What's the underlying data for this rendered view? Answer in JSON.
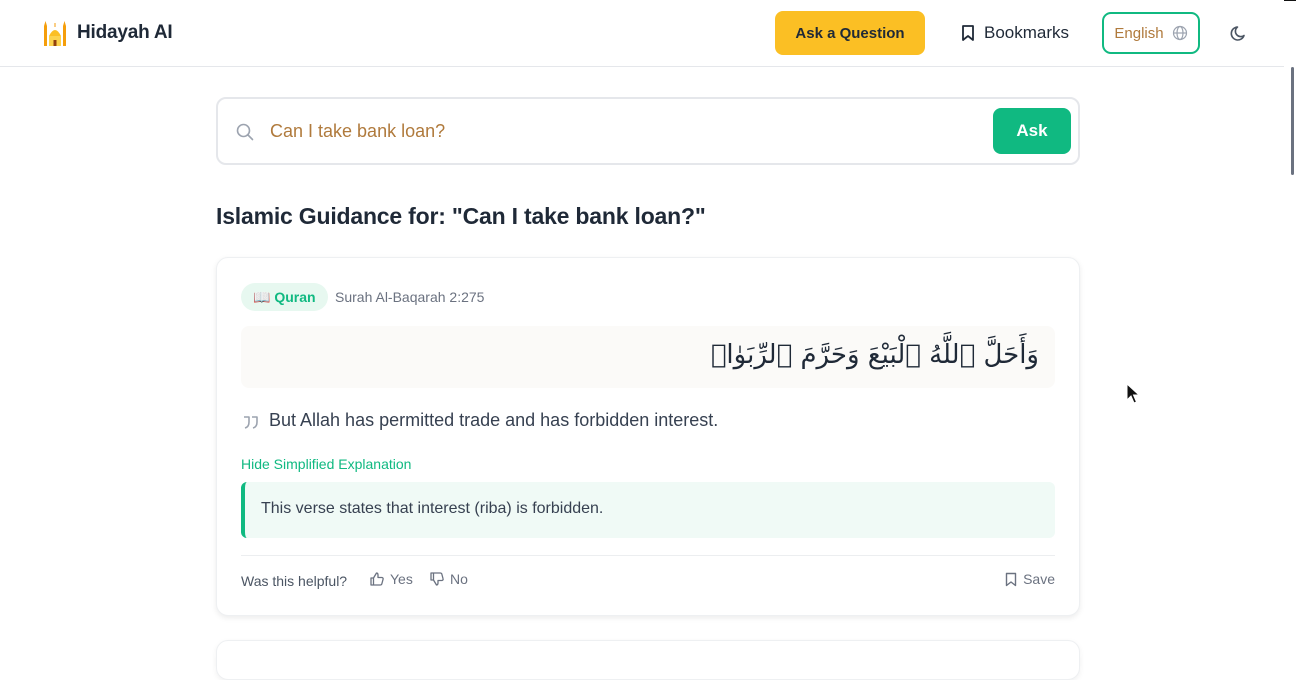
{
  "app": {
    "name": "Hidayah AI",
    "logo_icon": "mosque-icon"
  },
  "header": {
    "ask_button": "Ask a Question",
    "bookmarks": "Bookmarks",
    "language": "English"
  },
  "search": {
    "query": "Can I take bank loan?",
    "submit": "Ask"
  },
  "results": {
    "heading": "Islamic Guidance for: \"Can I take bank loan?\"",
    "cards": [
      {
        "source_badge": "📖 Quran",
        "reference": "Surah Al-Baqarah 2:275",
        "arabic": "وَأَحَلَّ ٱللَّهُ ٱلْبَيْعَ وَحَرَّمَ ٱلرِّبَوٰا۟",
        "translation": "But Allah has permitted trade and has forbidden interest.",
        "explanation_toggle": "Hide Simplified Explanation",
        "explanation": "This verse states that interest (riba) is forbidden.",
        "feedback": {
          "prompt": "Was this helpful?",
          "yes": "Yes",
          "no": "No"
        },
        "save": "Save"
      }
    ]
  },
  "colors": {
    "accent_green": "#10b981",
    "accent_yellow": "#fbbf24",
    "placeholder_brown": "#b07a3c"
  }
}
